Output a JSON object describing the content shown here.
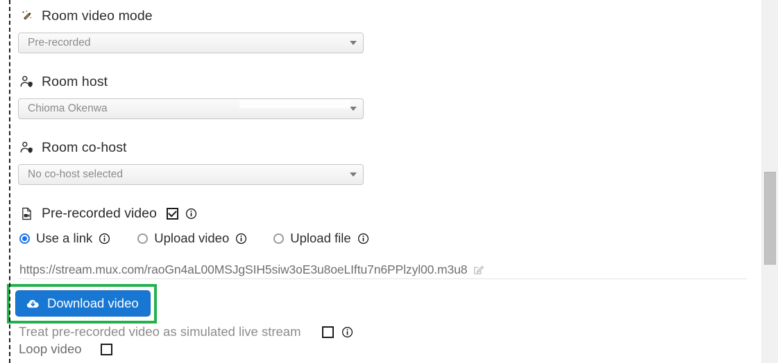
{
  "form": {
    "fields": [
      {
        "label": "Room video mode",
        "icon": "magic-wand-icon",
        "value": "Pre-recorded",
        "control": "select"
      },
      {
        "label": "Room host",
        "icon": "person-shield-icon",
        "value": "Chioma Okenwa",
        "control": "select"
      },
      {
        "label": "Room co-host",
        "icon": "person-shield-icon",
        "value": "No co-host selected",
        "control": "select"
      }
    ],
    "prerecorded": {
      "icon": "video-file-icon",
      "label": "Pre-recorded video",
      "checked": true,
      "info_icon": "info-icon"
    },
    "source_options": [
      {
        "label": "Use a link",
        "selected": true,
        "info_icon": "info-icon"
      },
      {
        "label": "Upload video",
        "selected": false,
        "info_icon": "info-icon"
      },
      {
        "label": "Upload file",
        "selected": false,
        "info_icon": "info-icon"
      }
    ],
    "video_url": "https://stream.mux.com/raoGn4aL00MSJgSIH5siw3oE3u8oeLIftu7n6PPlzyl00.m3u8",
    "url_edit_icon": "edit-pencil-icon",
    "download_button": {
      "label": "Download video",
      "icon": "cloud-download-icon",
      "highlighted": true
    },
    "toggles": [
      {
        "label": "Treat pre-recorded video as simulated live stream",
        "checked": false,
        "info_icon": "info-icon"
      },
      {
        "label": "Loop video",
        "checked": false
      }
    ]
  },
  "colors": {
    "button_blue": "#1877d2",
    "highlight_green": "#22b14c",
    "radio_blue": "#1a73e8",
    "muted_text": "#8c8c8c",
    "url_text": "#6f6f6f"
  },
  "scrollbar": {
    "name": "vertical-scrollbar"
  }
}
